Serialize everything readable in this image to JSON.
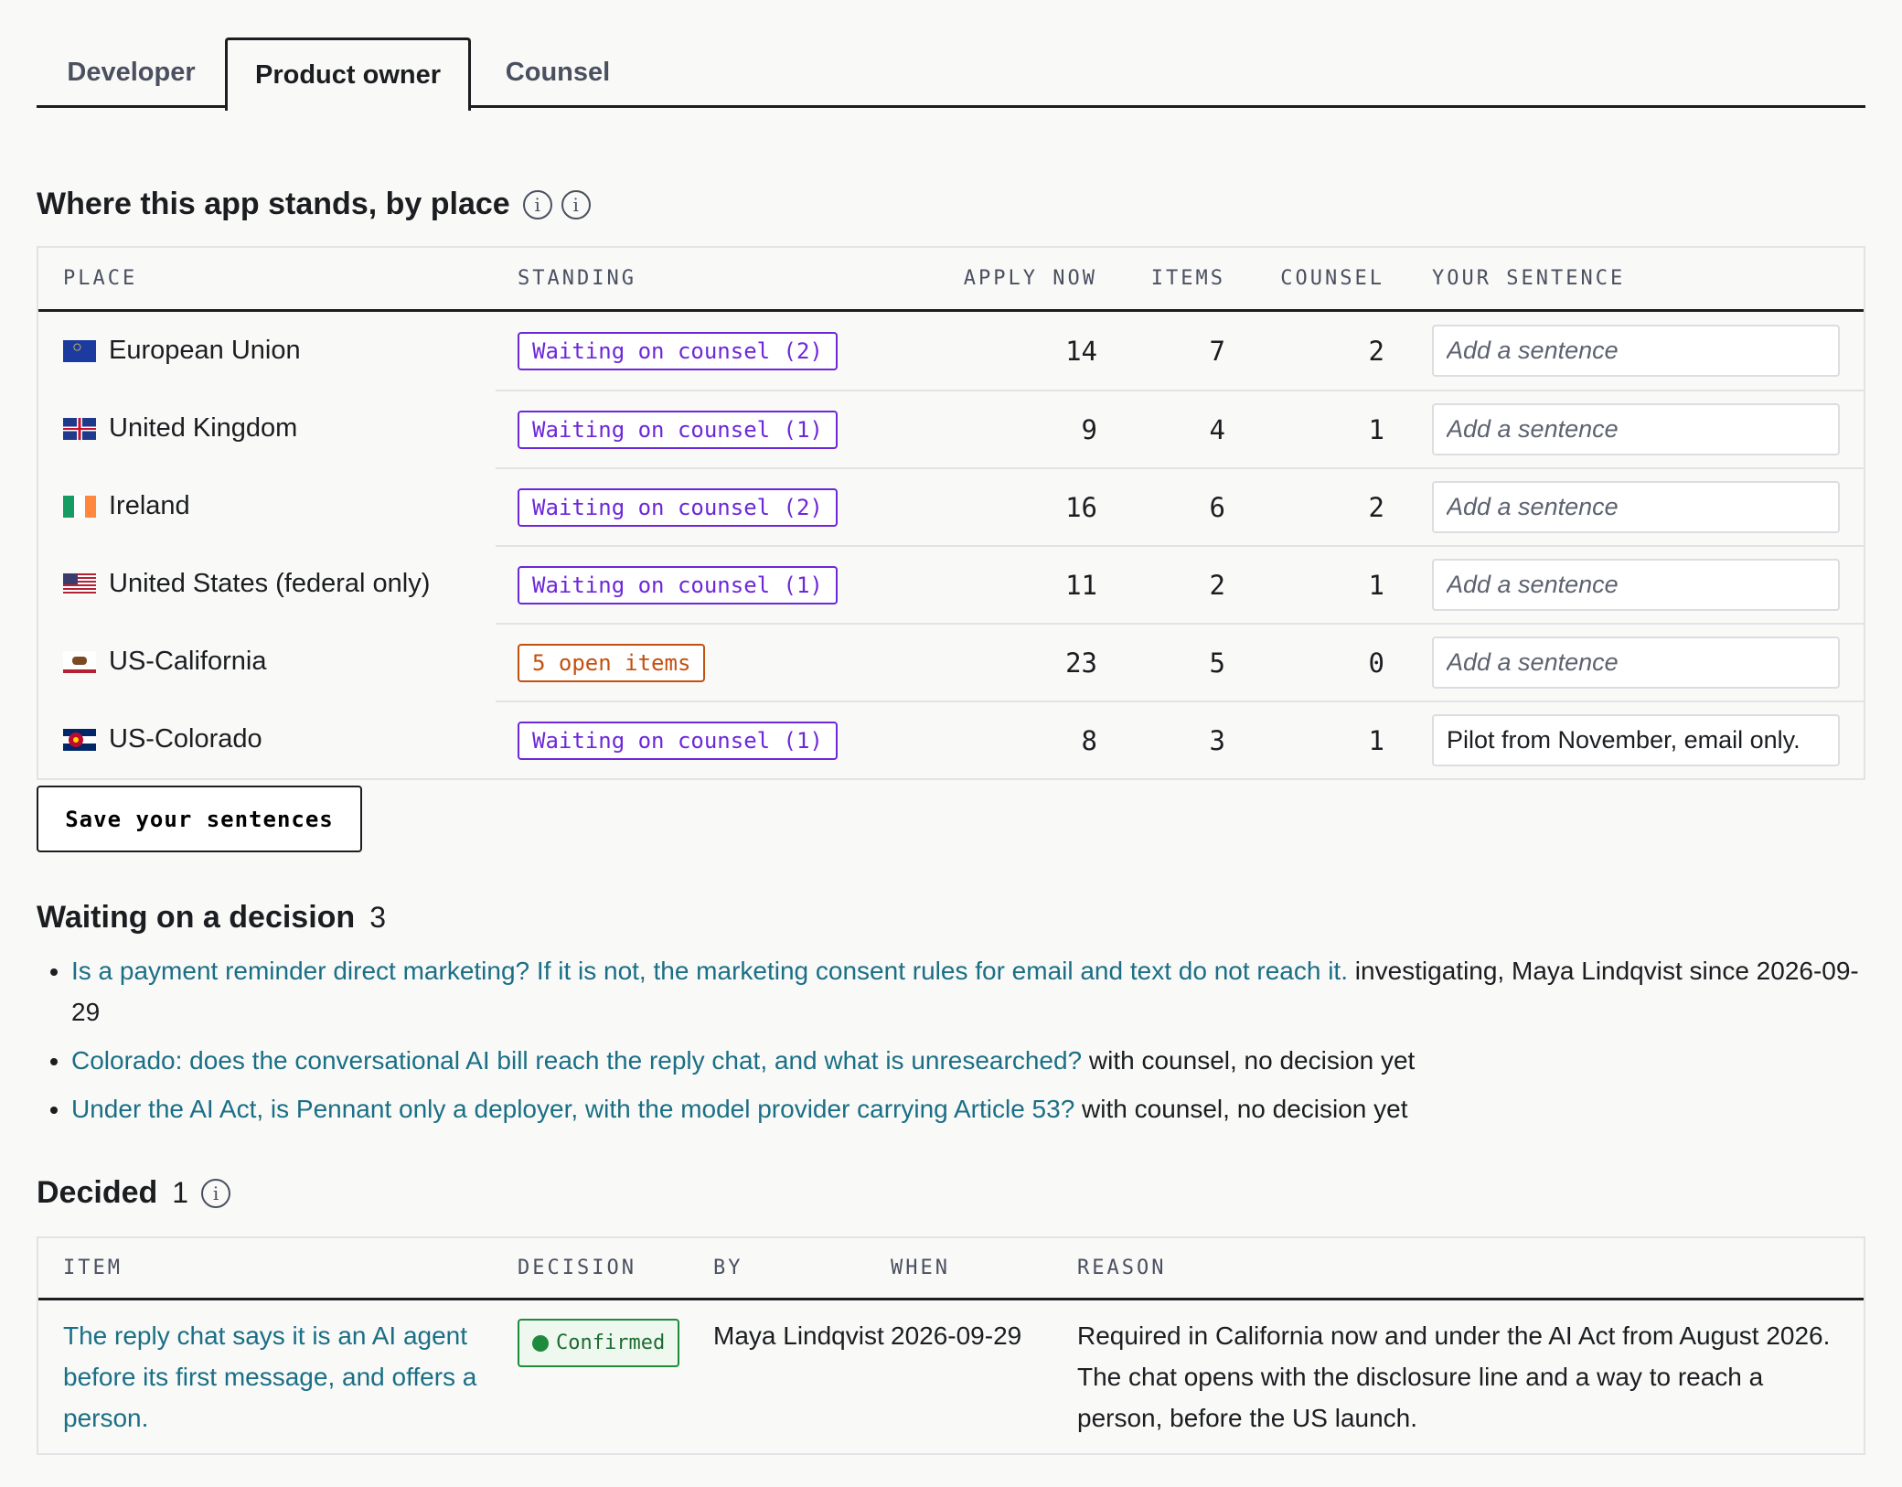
{
  "tabs": [
    {
      "label": "Developer"
    },
    {
      "label": "Product owner"
    },
    {
      "label": "Counsel"
    }
  ],
  "standing": {
    "title": "Where this app stands, by place",
    "columns": [
      "PLACE",
      "STANDING",
      "APPLY NOW",
      "ITEMS",
      "COUNSEL",
      "YOUR SENTENCE"
    ],
    "placeholder": "Add a sentence",
    "rows": [
      {
        "place": "European Union",
        "flag": "eu-flag-icon",
        "standing": "Waiting on counsel (2)",
        "apply_now": "14",
        "items": "7",
        "counsel": "2",
        "sentence": ""
      },
      {
        "place": "United Kingdom",
        "flag": "uk-flag-icon",
        "standing": "Waiting on counsel (1)",
        "apply_now": "9",
        "items": "4",
        "counsel": "1",
        "sentence": ""
      },
      {
        "place": "Ireland",
        "flag": "ireland-flag-icon",
        "standing": "Waiting on counsel (2)",
        "apply_now": "16",
        "items": "6",
        "counsel": "2",
        "sentence": ""
      },
      {
        "place": "United States (federal only)",
        "flag": "us-flag-icon",
        "standing": "Waiting on counsel (1)",
        "apply_now": "11",
        "items": "2",
        "counsel": "1",
        "sentence": ""
      },
      {
        "place": "US-California",
        "flag": "california-flag-icon",
        "standing": "5 open items",
        "apply_now": "23",
        "items": "5",
        "counsel": "0",
        "sentence": ""
      },
      {
        "place": "US-Colorado",
        "flag": "colorado-flag-icon",
        "standing": "Waiting on counsel (1)",
        "apply_now": "8",
        "items": "3",
        "counsel": "1",
        "sentence": "Pilot from November, email only."
      }
    ],
    "save_label": "Save your sentences"
  },
  "waiting": {
    "title": "Waiting on a decision",
    "count": "3",
    "items": [
      {
        "question": "Is a payment reminder direct marketing? If it is not, the marketing consent rules for email and text do not reach it.",
        "status": " investigating, Maya Lindqvist since 2026-09-29"
      },
      {
        "question": "Colorado: does the conversational AI bill reach the reply chat, and what is unresearched?",
        "status": " with counsel, no decision yet"
      },
      {
        "question": "Under the AI Act, is Pennant only a deployer, with the model provider carrying Article 53?",
        "status": " with counsel, no decision yet"
      }
    ]
  },
  "decided": {
    "title": "Decided",
    "count": "1",
    "columns": [
      "ITEM",
      "DECISION",
      "BY",
      "WHEN",
      "REASON"
    ],
    "rows": [
      {
        "item": "The reply chat says it is an AI agent before its first message, and offers a person.",
        "decision": "Confirmed",
        "by": "Maya Lindqvist",
        "when": "2026-09-29",
        "reason": "Required in California now and under the AI Act from August 2026. The chat opens with the disclosure line and a way to reach a person, before the US launch."
      }
    ]
  }
}
